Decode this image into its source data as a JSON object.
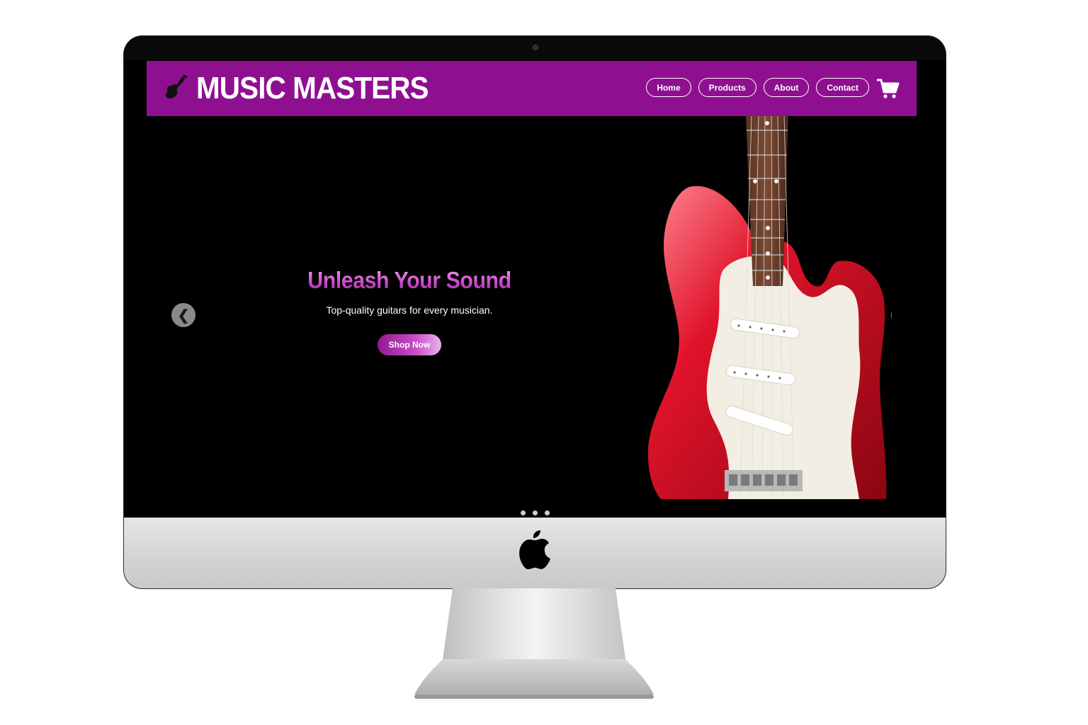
{
  "brand": {
    "name": "MUSIC MASTERS",
    "icon": "guitar-icon",
    "bar_color": "#8e1090"
  },
  "nav": {
    "items": [
      {
        "label": "Home"
      },
      {
        "label": "Products"
      },
      {
        "label": "About"
      },
      {
        "label": "Contact"
      }
    ],
    "cart_icon": "shopping-cart-icon"
  },
  "hero": {
    "title": "Unleash Your Sound",
    "subtitle": "Top-quality guitars for every musician.",
    "cta_label": "Shop Now",
    "prev_glyph": "❮",
    "next_glyph": "❯",
    "slide_count": 3,
    "image": "electric-guitar-photo"
  },
  "device": {
    "logo": "apple-logo"
  }
}
